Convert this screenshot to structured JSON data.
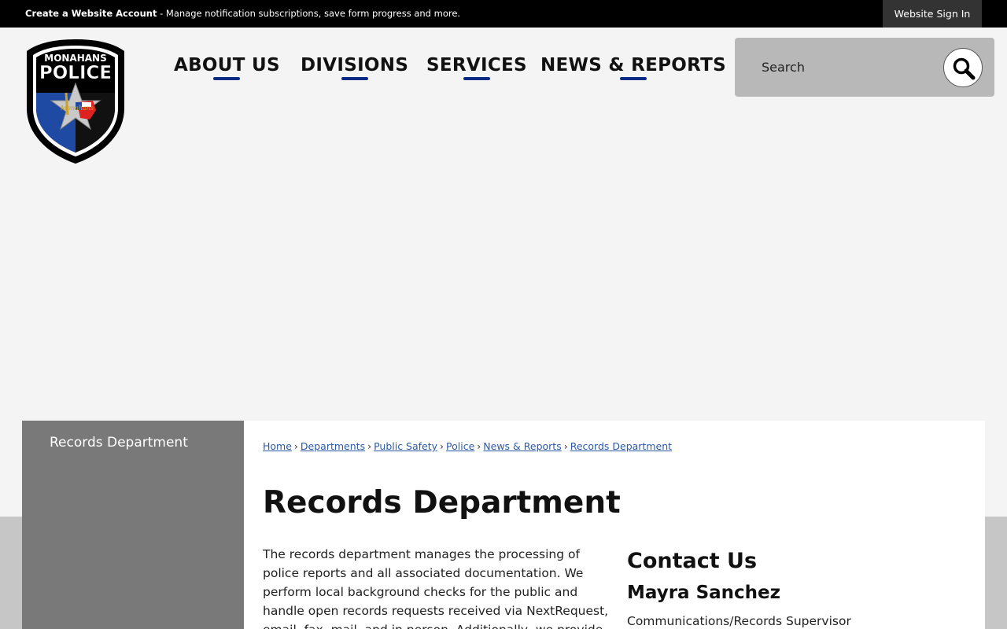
{
  "topbar": {
    "create_account": "Create a Website Account",
    "message": " - Manage notification subscriptions, save form progress and more.",
    "signin_label": "Website Sign In"
  },
  "logo": {
    "text_top": "MONAHANS",
    "text_main": "POLICE",
    "text_city": "Monahans"
  },
  "nav": {
    "items": [
      {
        "label": "ABOUT US"
      },
      {
        "label": "DIVISIONS"
      },
      {
        "label": "SERVICES"
      },
      {
        "label": "NEWS & REPORTS"
      }
    ]
  },
  "search": {
    "placeholder": "Search"
  },
  "sidebar": {
    "items": [
      {
        "label": "Records Department"
      }
    ]
  },
  "breadcrumb": {
    "items": [
      "Home",
      "Departments",
      "Public Safety",
      "Police",
      "News & Reports",
      "Records Department"
    ],
    "separator": "›"
  },
  "page": {
    "title": "Records Department",
    "intro": "The records department manages the processing of police reports and all associated documentation. We perform local background checks for the public and handle open records requests received via NextRequest, email, fax, mail, and in person. Additionally, we provide"
  },
  "contact": {
    "title": "Contact Us",
    "name": "Mayra Sanchez",
    "role": "Communications/Records Supervisor"
  },
  "colors": {
    "accent": "#0b2a84",
    "sidebar": "#797979",
    "topbar": "#000000",
    "link": "#2a5aa8"
  }
}
